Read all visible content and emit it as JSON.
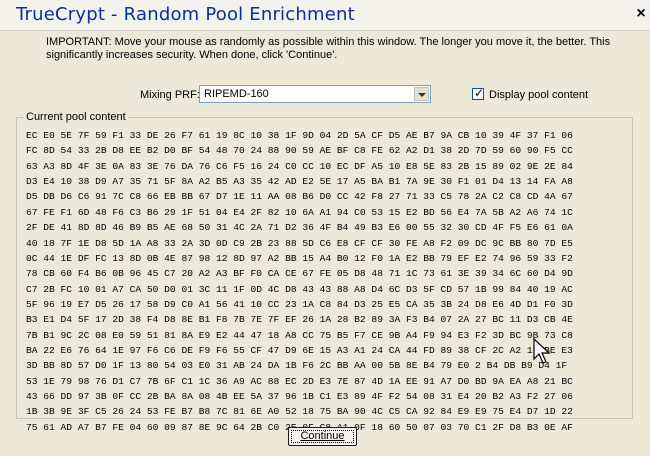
{
  "window": {
    "title": "TrueCrypt - Random Pool Enrichment",
    "close_glyph": "×"
  },
  "info_text": "IMPORTANT: Move your mouse as randomly as possible within this window. The longer you move it, the better. This significantly increases security. When done, click 'Continue'.",
  "mixing_prf": {
    "label": "Mixing PRF:",
    "value": "RIPEMD-160"
  },
  "display_pool": {
    "label": "Display pool content",
    "checked": true
  },
  "pool": {
    "label": "Current pool content",
    "lines": [
      "EC E0 5E 7F 59 F1 33 DE 26 F7 61 19 8C 10 38 1F 9D 04 2D 5A CF D5 AE B7 9A CB 10 39 4F 37 F1 06",
      "FC 8D 54 33 2B D8 EE B2 D0 BF 54 48 70 24 88 90 59 AE BF C8 FE 62 A2 D1 38 2D 7D 59 60 90 F5 CC",
      "63 A3 8D 4F 3E 0A 83 3E 76 DA 76 C6 F5 16 24 C0 CC 10 EC DF A5 10 E8 5E 83 2B 15 89 02 9E 2E 84",
      "D3 E4 10 38 D9 A7 35 71 5F 8A A2 B5 A3 35 42 AD E2 5E 17 A5 BA B1 7A 9E 30 F1 01 D4 13 14 FA A8",
      "D5 DB D6 C6 91 7C C8 66 EB BB 67 D7 1E 11 AA 08 B6 D0 CC 42 F8 27 71 33 C5 78 2A C2 C8 CD 4A 67",
      "67 FE F1 6D 48 F6 C3 B6 29 1F 51 04 E4 2F 82 10 6A A1 94 C0 53 15 E2 BD 56 E4 7A 5B A2 A6 74 1C",
      "2F DE 41 8D 8D 46 B9 B5 AE 68 50 31 4C 2A 71 D2 36 4F B4 49 B3 E6 00 55 32 30 CD 4F F5 E6 61 0A",
      "40 18 7F 1E D8 5D 1A A8 33 2A 3D 0D C9 2B 23 88 5D C6 E8 CF CF 30 FE A8 F2 09 DC 9C BB 80 7D E5",
      "0C 44 1E DF FC 13 8D 0B 4E 87 98 12 8D 97 A2 BB 15 A4 B0 12 F0 1A E2 BB 79 EF E2 74 96 59 33 F2",
      "78 CB 60 F4 B6 0B 96 45 C7 20 A2 A3 BF F0 CA CE 67 FE 05 D8 48 71 1C 73 61 3E 39 34 6C 60 D4 9D",
      "C7 2B FC 10 01 A7 CA 50 D0 01 3C 11 1F 0D 4C D8 43 43 88 A8 D4 6C D3 5F CD 57 1B 99 84 40 19 AC",
      "5F 96 19 E7 D5 26 17 58 D9 C0 A1 56 41 10 CC 23 1A C8 84 D3 25 E5 CA 35 3B 24 D8 E6 4D D1 F0 3D",
      "B3 E1 D4 5F 17 2D 38 F4 D8 8E B1 F8 7B 7E 7F EF 26 1A 28 B2 89 3A F3 B4 07 2A 27 BC 11 D3 CB 4E",
      "7B B1 9C 2C 08 E0 59 51 81 8A E9 E2 44 47 18 A8 CC 75 B5 F7 CE 9B A4 F9 94 E3 F2 3D BC 9B 73 C8",
      "BA 22 E6 76 64 1E 97 F6 C6 DE F9 F6 55 CF 47 D9 6E 15 A3 A1 24 CA 44 FD 89 38 CF 2C A2 19 BE E3",
      "3D BB 8D 57 D0 1F 13 80 54 03 E0 31 AB 24 DA 1B F6 2C BB AA 00 5B 8E B4 79 E0 2 B4 DB B9 D4 1F",
      "53 1E 79 98 76 D1 C7 7B 6F C1 1C 36 A9 AC 88 EC 2D E3 7E 87 4D 1A EE 91 A7 D0 BD 9A EA A8 21 BC",
      "43 66 DD 97 3B 0F CC 2B BA 8A 08 4B EE 5A 37 96 1B C1 E3 89 4F F2 54 08 31 E4 20 B2 A3 F2 27 06",
      "1B 3B 9E 3F C5 26 24 53 FE B7 B8 7C 81 6E A0 52 18 75 BA 90 4C C5 CA 92 84 E9 E9 75 E4 D7 1D 22",
      "75 61 AD A7 B7 FE 04 60 09 87 8E 9C 64 2B C0 2E 0F C8 A1 0F 18 60 50 07 03 70 C1 2F D8 B3 0E AF"
    ]
  },
  "continue_label": "Continue"
}
